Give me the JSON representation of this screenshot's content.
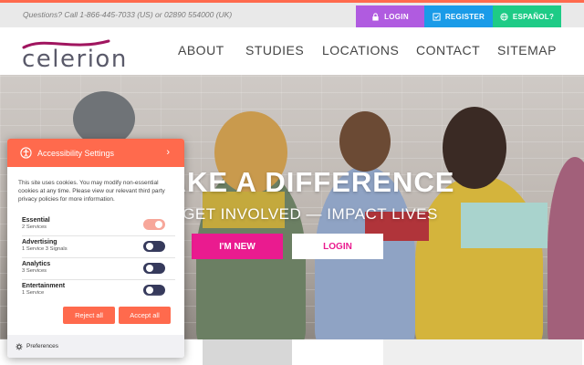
{
  "topbar": {
    "question": "Questions? Call 1-866-445-7033 (US) or 02890 554000 (UK)",
    "login": "LOGIN",
    "register": "REGISTER",
    "espanol": "ESPAÑOL?"
  },
  "header": {
    "logo_text": "celerion",
    "nav": [
      "ABOUT",
      "STUDIES",
      "LOCATIONS",
      "CONTACT",
      "SITEMAP"
    ]
  },
  "hero": {
    "title": "AKE A DIFFERENCE",
    "subtitle": "GET INVOLVED — IMPACT LIVES",
    "btn_new": "I'M NEW",
    "btn_login": "LOGIN"
  },
  "cookie": {
    "title": "Accessibility Settings",
    "description": "This site uses cookies. You may modify non-essential cookies at any time. Please view our relevant third party privacy policies for more information.",
    "categories": [
      {
        "name": "Essential",
        "sub": "2 Services",
        "enabled": true
      },
      {
        "name": "Advertising",
        "sub": "1 Service  3 Signals",
        "enabled": false
      },
      {
        "name": "Analytics",
        "sub": "3 Services",
        "enabled": false
      },
      {
        "name": "Entertainment",
        "sub": "1 Service",
        "enabled": false
      }
    ],
    "reject": "Reject all",
    "accept": "Accept all",
    "preferences": "Preferences"
  },
  "colors": {
    "accent": "#ff6a4d",
    "brand_pink": "#ea1b8f",
    "login_purple": "#b05be0",
    "register_blue": "#1a9be8",
    "espanol_green": "#1ecb86"
  },
  "icons": {
    "login": "lock-icon",
    "register": "checkbox-icon",
    "espanol": "globe-icon",
    "cookie_header": "accessibility-icon",
    "preferences": "gear-icon"
  }
}
